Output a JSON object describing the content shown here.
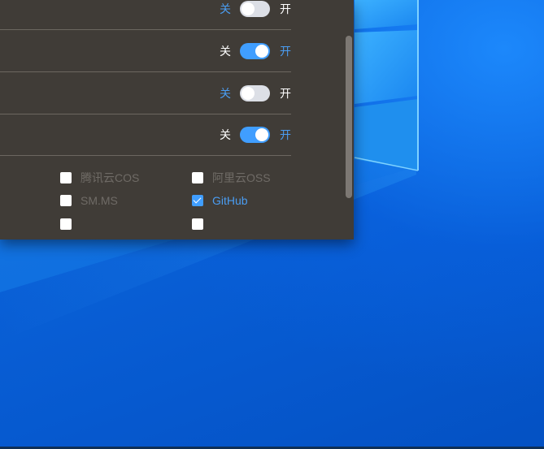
{
  "settings": {
    "rows": [
      {
        "off_label": "关",
        "on_label": "开",
        "enabled": false
      },
      {
        "off_label": "关",
        "on_label": "开",
        "enabled": true
      },
      {
        "off_label": "关",
        "on_label": "开",
        "enabled": false
      },
      {
        "off_label": "关",
        "on_label": "开",
        "enabled": true
      }
    ],
    "uploaders": [
      {
        "label": "腾讯云COS",
        "checked": false
      },
      {
        "label": "阿里云OSS",
        "checked": false
      },
      {
        "label": "SM.MS",
        "checked": false
      },
      {
        "label": "GitHub",
        "checked": true
      }
    ]
  },
  "colors": {
    "panel_bg": "#403c37",
    "accent": "#409eff",
    "accent_text": "#4a9df2",
    "muted_text": "#6f6b66",
    "desktop_bg": "#0a5fd6"
  }
}
